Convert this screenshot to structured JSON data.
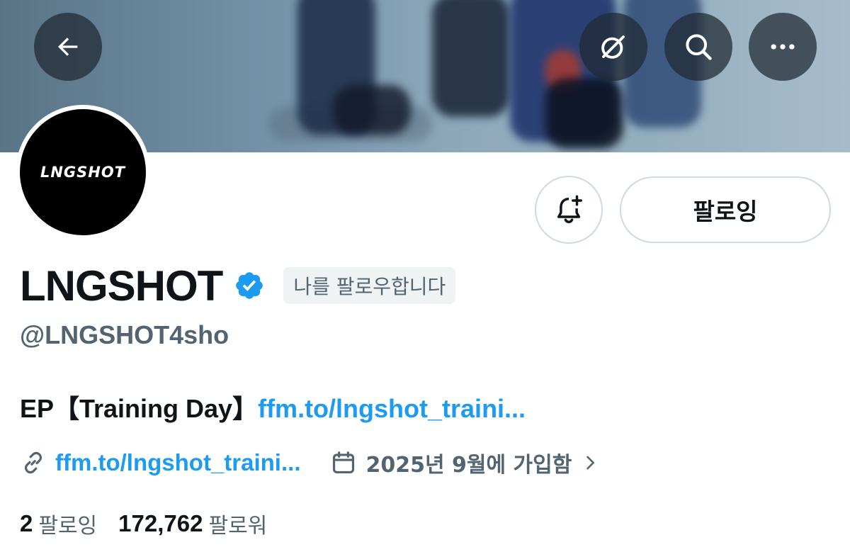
{
  "header": {
    "back_icon": "arrow-left-icon",
    "grok_icon": "grok-icon",
    "search_icon": "search-icon",
    "more_icon": "more-horizontal-icon"
  },
  "profile": {
    "avatar_text": "LNGSHOT",
    "display_name": "LNGSHOT",
    "verified": true,
    "follows_you_badge": "나를 팔로우합니다",
    "handle": "@LNGSHOT4sho",
    "bio_text": "EP【Training Day】",
    "bio_link": "ffm.to/lngshot_traini...",
    "website": "ffm.to/lngshot_traini...",
    "joined": "2025년 9월에 가입함",
    "following_count": "2",
    "following_label": "팔로잉",
    "followers_count": "172,762",
    "followers_label": "팔로워"
  },
  "actions": {
    "notify_icon": "bell-plus-icon",
    "following_button": "팔로잉"
  },
  "colors": {
    "accent": "#1d9bf0",
    "secondary_text": "#536471",
    "primary_text": "#0f1419",
    "border": "#cfd9de"
  }
}
